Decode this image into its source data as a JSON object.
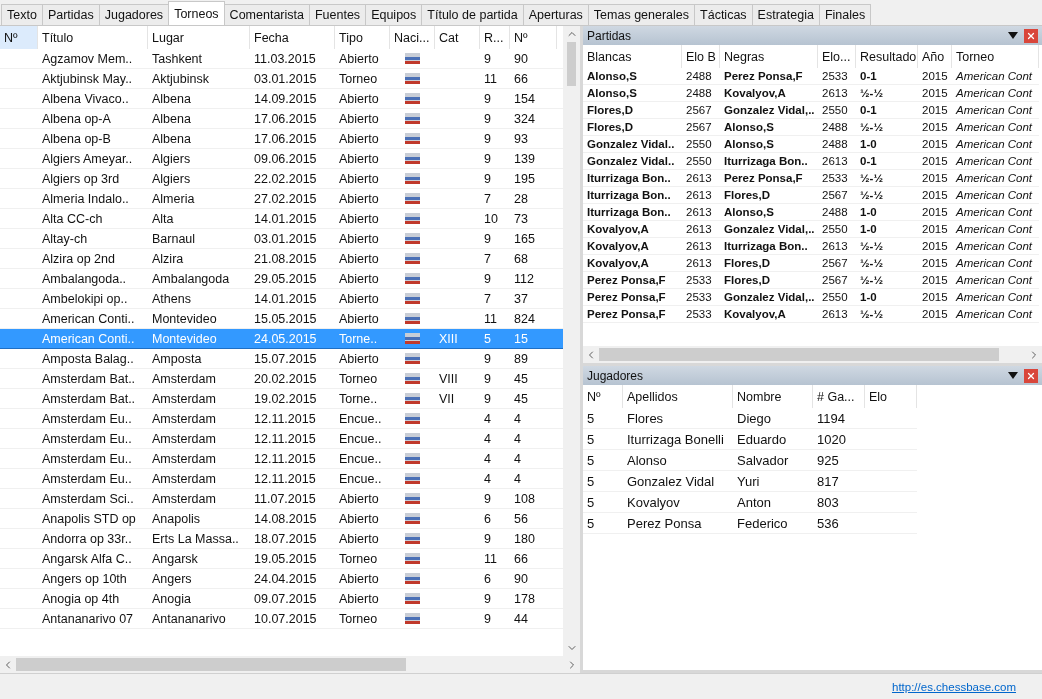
{
  "tabs": [
    {
      "label": "Texto",
      "selected": false
    },
    {
      "label": "Partidas",
      "selected": false
    },
    {
      "label": "Jugadores",
      "selected": false
    },
    {
      "label": "Torneos",
      "selected": true
    },
    {
      "label": "Comentarista",
      "selected": false
    },
    {
      "label": "Fuentes",
      "selected": false
    },
    {
      "label": "Equipos",
      "selected": false
    },
    {
      "label": "Título de partida",
      "selected": false
    },
    {
      "label": "Aperturas",
      "selected": false
    },
    {
      "label": "Temas generales",
      "selected": false
    },
    {
      "label": "Tácticas",
      "selected": false
    },
    {
      "label": "Estrategia",
      "selected": false
    },
    {
      "label": "Finales",
      "selected": false
    }
  ],
  "tournaments": {
    "columns": [
      "Nº",
      "Título",
      "Lugar",
      "Fecha",
      "Tipo",
      "Naci...",
      "Cat",
      "R...",
      "Nº"
    ],
    "rows": [
      {
        "title": "Agzamov Mem..",
        "place": "Tashkent",
        "date": "11.03.2015",
        "type": "Abierto",
        "rounds": "9",
        "games": "90",
        "selected": false
      },
      {
        "title": "Aktjubinsk May..",
        "place": "Aktjubinsk",
        "date": "03.01.2015",
        "type": "Torneo",
        "rounds": "11",
        "games": "66",
        "selected": false
      },
      {
        "title": "Albena Vivaco..",
        "place": "Albena",
        "date": "14.09.2015",
        "type": "Abierto",
        "rounds": "9",
        "games": "154",
        "selected": false
      },
      {
        "title": "Albena op-A",
        "place": "Albena",
        "date": "17.06.2015",
        "type": "Abierto",
        "rounds": "9",
        "games": "324",
        "selected": false
      },
      {
        "title": "Albena op-B",
        "place": "Albena",
        "date": "17.06.2015",
        "type": "Abierto",
        "rounds": "9",
        "games": "93",
        "selected": false
      },
      {
        "title": "Algiers Ameyar..",
        "place": "Algiers",
        "date": "09.06.2015",
        "type": "Abierto",
        "rounds": "9",
        "games": "139",
        "selected": false
      },
      {
        "title": "Algiers op 3rd",
        "place": "Algiers",
        "date": "22.02.2015",
        "type": "Abierto",
        "rounds": "9",
        "games": "195",
        "selected": false
      },
      {
        "title": "Almeria Indalo..",
        "place": "Almeria",
        "date": "27.02.2015",
        "type": "Abierto",
        "rounds": "7",
        "games": "28",
        "selected": false
      },
      {
        "title": "Alta CC-ch",
        "place": "Alta",
        "date": "14.01.2015",
        "type": "Abierto",
        "rounds": "10",
        "games": "73",
        "selected": false
      },
      {
        "title": "Altay-ch",
        "place": "Barnaul",
        "date": "03.01.2015",
        "type": "Abierto",
        "rounds": "9",
        "games": "165",
        "selected": false
      },
      {
        "title": "Alzira op 2nd",
        "place": "Alzira",
        "date": "21.08.2015",
        "type": "Abierto",
        "rounds": "7",
        "games": "68",
        "selected": false
      },
      {
        "title": "Ambalangoda..",
        "place": "Ambalangoda",
        "date": "29.05.2015",
        "type": "Abierto",
        "rounds": "9",
        "games": "112",
        "selected": false
      },
      {
        "title": "Ambelokipi op..",
        "place": "Athens",
        "date": "14.01.2015",
        "type": "Abierto",
        "rounds": "7",
        "games": "37",
        "selected": false
      },
      {
        "title": "American Conti..",
        "place": "Montevideo",
        "date": "15.05.2015",
        "type": "Abierto",
        "rounds": "11",
        "games": "824",
        "selected": false
      },
      {
        "title": "American Conti..",
        "place": "Montevideo",
        "date": "24.05.2015",
        "type": "Torne..",
        "cat": "XIII",
        "rounds": "5",
        "games": "15",
        "selected": true
      },
      {
        "title": "Amposta Balag..",
        "place": "Amposta",
        "date": "15.07.2015",
        "type": "Abierto",
        "rounds": "9",
        "games": "89",
        "selected": false
      },
      {
        "title": "Amsterdam Bat..",
        "place": "Amsterdam",
        "date": "20.02.2015",
        "type": "Torneo",
        "cat": "VIII",
        "rounds": "9",
        "games": "45",
        "selected": false
      },
      {
        "title": "Amsterdam Bat..",
        "place": "Amsterdam",
        "date": "19.02.2015",
        "type": "Torne..",
        "cat": "VII",
        "rounds": "9",
        "games": "45",
        "selected": false
      },
      {
        "title": "Amsterdam Eu..",
        "place": "Amsterdam",
        "date": "12.11.2015",
        "type": "Encue..",
        "rounds": "4",
        "games": "4",
        "selected": false
      },
      {
        "title": "Amsterdam Eu..",
        "place": "Amsterdam",
        "date": "12.11.2015",
        "type": "Encue..",
        "rounds": "4",
        "games": "4",
        "selected": false
      },
      {
        "title": "Amsterdam Eu..",
        "place": "Amsterdam",
        "date": "12.11.2015",
        "type": "Encue..",
        "rounds": "4",
        "games": "4",
        "selected": false
      },
      {
        "title": "Amsterdam Eu..",
        "place": "Amsterdam",
        "date": "12.11.2015",
        "type": "Encue..",
        "rounds": "4",
        "games": "4",
        "selected": false
      },
      {
        "title": "Amsterdam Sci..",
        "place": "Amsterdam",
        "date": "11.07.2015",
        "type": "Abierto",
        "rounds": "9",
        "games": "108",
        "selected": false
      },
      {
        "title": "Anapolis STD op",
        "place": "Anapolis",
        "date": "14.08.2015",
        "type": "Abierto",
        "rounds": "6",
        "games": "56",
        "selected": false
      },
      {
        "title": "Andorra op 33r..",
        "place": "Erts La Massa..",
        "date": "18.07.2015",
        "type": "Abierto",
        "rounds": "9",
        "games": "180",
        "selected": false
      },
      {
        "title": "Angarsk Alfa C..",
        "place": "Angarsk",
        "date": "19.05.2015",
        "type": "Torneo",
        "rounds": "11",
        "games": "66",
        "selected": false
      },
      {
        "title": "Angers op 10th",
        "place": "Angers",
        "date": "24.04.2015",
        "type": "Abierto",
        "rounds": "6",
        "games": "90",
        "selected": false
      },
      {
        "title": "Anogia op 4th",
        "place": "Anogia",
        "date": "09.07.2015",
        "type": "Abierto",
        "rounds": "9",
        "games": "178",
        "selected": false
      },
      {
        "title": "Antananarivo 07",
        "place": "Antananarivo",
        "date": "10.07.2015",
        "type": "Torneo",
        "rounds": "9",
        "games": "44",
        "selected": false
      }
    ]
  },
  "games_panel": {
    "title": "Partidas",
    "columns": [
      "Blancas",
      "Elo B",
      "Negras",
      "Elo...",
      "Resultado",
      "Año",
      "Torneo"
    ],
    "rows": [
      [
        "Alonso,S",
        "2488",
        "Perez Ponsa,F",
        "2533",
        "0-1",
        "2015",
        "American Cont"
      ],
      [
        "Alonso,S",
        "2488",
        "Kovalyov,A",
        "2613",
        "½-½",
        "2015",
        "American Cont"
      ],
      [
        "Flores,D",
        "2567",
        "Gonzalez Vidal,..",
        "2550",
        "0-1",
        "2015",
        "American Cont"
      ],
      [
        "Flores,D",
        "2567",
        "Alonso,S",
        "2488",
        "½-½",
        "2015",
        "American Cont"
      ],
      [
        "Gonzalez Vidal..",
        "2550",
        "Alonso,S",
        "2488",
        "1-0",
        "2015",
        "American Cont"
      ],
      [
        "Gonzalez Vidal..",
        "2550",
        "Iturrizaga Bon..",
        "2613",
        "0-1",
        "2015",
        "American Cont"
      ],
      [
        "Iturrizaga Bon..",
        "2613",
        "Perez Ponsa,F",
        "2533",
        "½-½",
        "2015",
        "American Cont"
      ],
      [
        "Iturrizaga Bon..",
        "2613",
        "Flores,D",
        "2567",
        "½-½",
        "2015",
        "American Cont"
      ],
      [
        "Iturrizaga Bon..",
        "2613",
        "Alonso,S",
        "2488",
        "1-0",
        "2015",
        "American Cont"
      ],
      [
        "Kovalyov,A",
        "2613",
        "Gonzalez Vidal,..",
        "2550",
        "1-0",
        "2015",
        "American Cont"
      ],
      [
        "Kovalyov,A",
        "2613",
        "Iturrizaga Bon..",
        "2613",
        "½-½",
        "2015",
        "American Cont"
      ],
      [
        "Kovalyov,A",
        "2613",
        "Flores,D",
        "2567",
        "½-½",
        "2015",
        "American Cont"
      ],
      [
        "Perez Ponsa,F",
        "2533",
        "Flores,D",
        "2567",
        "½-½",
        "2015",
        "American Cont"
      ],
      [
        "Perez Ponsa,F",
        "2533",
        "Gonzalez Vidal,..",
        "2550",
        "1-0",
        "2015",
        "American Cont"
      ],
      [
        "Perez Ponsa,F",
        "2533",
        "Kovalyov,A",
        "2613",
        "½-½",
        "2015",
        "American Cont"
      ]
    ]
  },
  "players_panel": {
    "title": "Jugadores",
    "columns": [
      "Nº",
      "Apellidos",
      "Nombre",
      "# Ga...",
      "Elo"
    ],
    "rows": [
      [
        "5",
        "Flores",
        "Diego",
        "1194"
      ],
      [
        "5",
        "Iturrizaga Bonelli",
        "Eduardo",
        "1020"
      ],
      [
        "5",
        "Alonso",
        "Salvador",
        "925"
      ],
      [
        "5",
        "Gonzalez Vidal",
        "Yuri",
        "817"
      ],
      [
        "5",
        "Kovalyov",
        "Anton",
        "803"
      ],
      [
        "5",
        "Perez Ponsa",
        "Federico",
        "536"
      ]
    ]
  },
  "status_bar": {
    "link": "http://es.chessbase.com"
  }
}
